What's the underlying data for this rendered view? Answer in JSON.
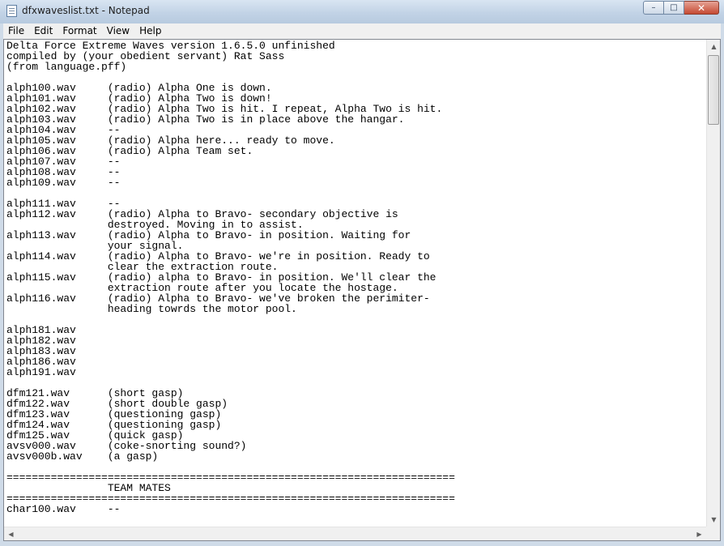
{
  "window": {
    "title": "dfxwaveslist.txt - Notepad",
    "buttons": {
      "minimize": "–",
      "maximize": "□",
      "close": "✕"
    }
  },
  "menu": [
    "File",
    "Edit",
    "Format",
    "View",
    "Help"
  ],
  "document": {
    "lines": [
      "Delta Force Extreme Waves version 1.6.5.0 unfinished",
      "compiled by (your obedient servant) Rat Sass",
      "(from language.pff)",
      "",
      "alph100.wav     (radio) Alpha One is down.",
      "alph101.wav     (radio) Alpha Two is down!",
      "alph102.wav     (radio) Alpha Two is hit. I repeat, Alpha Two is hit.",
      "alph103.wav     (radio) Alpha Two is in place above the hangar.",
      "alph104.wav     --",
      "alph105.wav     (radio) Alpha here... ready to move.",
      "alph106.wav     (radio) Alpha Team set.",
      "alph107.wav     --",
      "alph108.wav     --",
      "alph109.wav     --",
      "",
      "alph111.wav     --",
      "alph112.wav     (radio) Alpha to Bravo- secondary objective is",
      "                destroyed. Moving in to assist.",
      "alph113.wav     (radio) Alpha to Bravo- in position. Waiting for",
      "                your signal.",
      "alph114.wav     (radio) Alpha to Bravo- we're in position. Ready to",
      "                clear the extraction route.",
      "alph115.wav     (radio) alpha to Bravo- in position. We'll clear the",
      "                extraction route after you locate the hostage.",
      "alph116.wav     (radio) Alpha to Bravo- we've broken the perimiter-",
      "                heading towrds the motor pool.",
      "",
      "alph181.wav",
      "alph182.wav",
      "alph183.wav",
      "alph186.wav",
      "alph191.wav",
      "",
      "dfm121.wav      (short gasp)",
      "dfm122.wav      (short double gasp)",
      "dfm123.wav      (questioning gasp)",
      "dfm124.wav      (questioning gasp)",
      "dfm125.wav      (quick gasp)",
      "avsv000.wav     (coke-snorting sound?)",
      "avsv000b.wav    (a gasp)",
      "",
      "=======================================================================",
      "                TEAM MATES",
      "=======================================================================",
      "char100.wav     --"
    ]
  },
  "scrollbar_icons": {
    "up": "▲",
    "down": "▼",
    "left": "◀",
    "right": "▶"
  }
}
